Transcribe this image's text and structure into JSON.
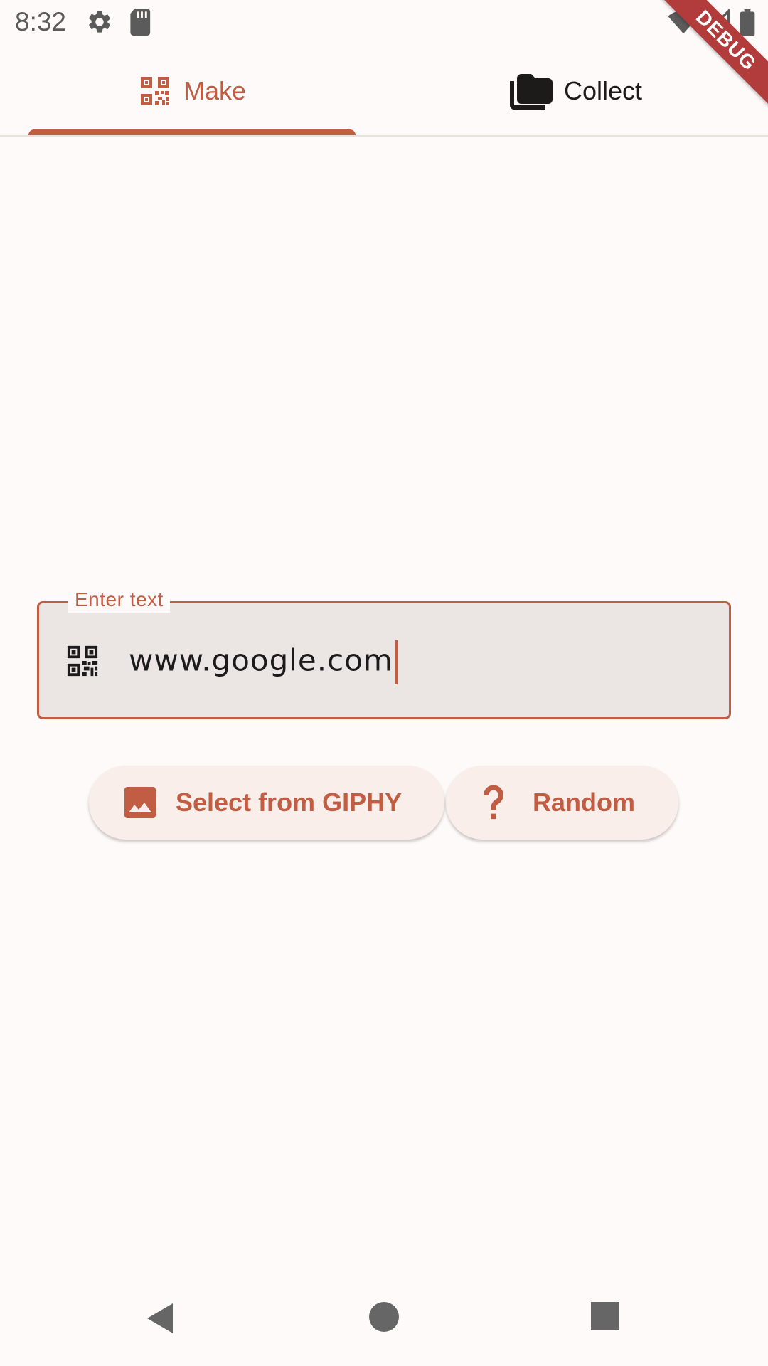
{
  "status_bar": {
    "time": "8:32",
    "icons": [
      "gear-icon",
      "sd-card-icon",
      "wifi-icon",
      "signal-icon",
      "battery-icon"
    ]
  },
  "debug_banner": "DEBUG",
  "tabs": [
    {
      "label": "Make",
      "icon": "qr-code-icon",
      "selected": true
    },
    {
      "label": "Collect",
      "icon": "folders-icon",
      "selected": false
    }
  ],
  "input": {
    "label": "Enter text",
    "value": "www.google.com",
    "prefix_icon": "qr-code-icon"
  },
  "buttons": {
    "giphy": {
      "label": "Select from GIPHY",
      "icon": "image-icon"
    },
    "random": {
      "label": "Random",
      "icon": "question-mark-icon"
    }
  },
  "colors": {
    "accent": "#C05D43",
    "background": "#FEFAF9",
    "field_fill": "#EBE5E3",
    "button_fill": "#F9EEEA",
    "debug_banner": "#B23B3B"
  }
}
